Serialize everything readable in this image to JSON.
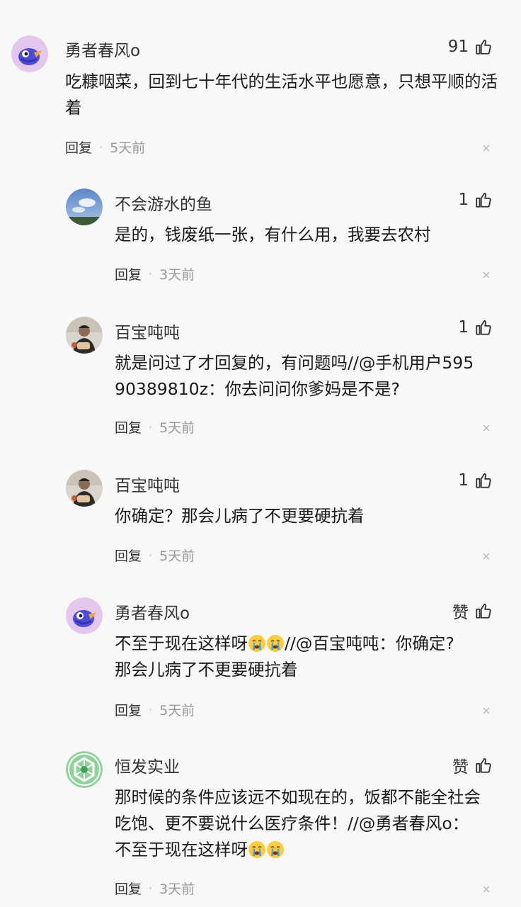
{
  "comments": [
    {
      "user": "勇者春风o",
      "likes": "91",
      "text": "吃糠咽菜，回到七十年代的生活水平也愿意，只想平顺的活着",
      "reply": "回复",
      "time": "5天前"
    },
    {
      "user": "不会游水的鱼",
      "likes": "1",
      "text": "是的，钱废纸一张，有什么用，我要去农村",
      "reply": "回复",
      "time": "3天前"
    },
    {
      "user": "百宝吨吨",
      "likes": "1",
      "text_line1": "就是问过了才回复的，有问题吗//@手机用户595",
      "text_line2": "90389810z：你去问问你爹妈是不是?",
      "reply": "回复",
      "time": "5天前"
    },
    {
      "user": "百宝吨吨",
      "likes": "1",
      "text": "你确定？那会儿病了不更要硬抗着",
      "reply": "回复",
      "time": "5天前"
    },
    {
      "user": "勇者春风o",
      "likes": "赞",
      "text_a": "不至于现在这样呀",
      "text_b": "//@百宝吨吨：你确定?",
      "text_line2": "那会儿病了不更要硬抗着",
      "reply": "回复",
      "time": "5天前"
    },
    {
      "user": "恒发实业",
      "likes": "赞",
      "text_line1": "那时候的条件应该远不如现在的，饭都不能全社会",
      "text_line2": "吃饱、更不要说什么医疗条件！//@勇者春风o：",
      "text_line3": "不至于现在这样呀",
      "reply": "回复",
      "time": "3天前"
    }
  ],
  "icons": {
    "like": "thumbs-up-icon",
    "close": "close-icon",
    "emoji": "crying-face-emoji"
  },
  "colors": {
    "background": "#f8f8f8",
    "text": "#1a1a1a",
    "time": "#999999"
  }
}
